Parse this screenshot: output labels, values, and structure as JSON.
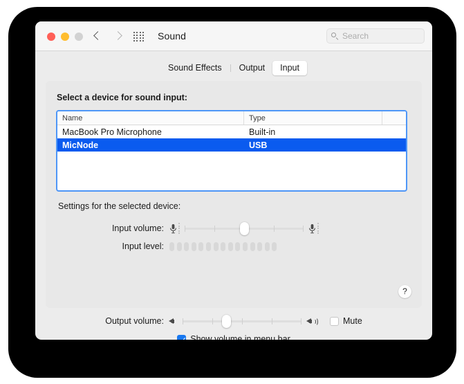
{
  "window": {
    "title": "Sound",
    "traffic_lights": [
      "close",
      "minimize",
      "zoom"
    ],
    "back_label": "Back",
    "forward_label": "Forward",
    "grid_label": "Show All"
  },
  "search": {
    "placeholder": "Search",
    "value": ""
  },
  "tabs": [
    {
      "label": "Sound Effects",
      "active": false
    },
    {
      "label": "Output",
      "active": false
    },
    {
      "label": "Input",
      "active": true
    }
  ],
  "device_section": {
    "heading": "Select a device for sound input:",
    "columns": [
      "Name",
      "Type"
    ],
    "rows": [
      {
        "name": "MacBook Pro Microphone",
        "type": "Built-in",
        "selected": false
      },
      {
        "name": "MicNode",
        "type": "USB",
        "selected": true
      }
    ]
  },
  "settings": {
    "heading": "Settings for the selected device:",
    "input_volume": {
      "label": "Input volume:",
      "value_percent": 50,
      "ticks": 5,
      "left_icon": "microphone-low-icon",
      "right_icon": "microphone-high-icon"
    },
    "input_level": {
      "label": "Input level:",
      "segments": 15,
      "active_segments": 0
    },
    "help_label": "?"
  },
  "output": {
    "label": "Output volume:",
    "value_percent": 37,
    "ticks": 5,
    "left_icon": "speaker-low-icon",
    "right_icon": "speaker-high-icon",
    "mute": {
      "label": "Mute",
      "checked": false
    }
  },
  "menu_bar_option": {
    "label": "Show volume in menu bar",
    "checked": true
  },
  "colors": {
    "selection_blue": "#0a5bef",
    "focus_ring": "#4e96f7",
    "checkbox_blue": "#1878f0",
    "window_bg": "#ececec",
    "panel_bg": "#e8e8e8"
  }
}
